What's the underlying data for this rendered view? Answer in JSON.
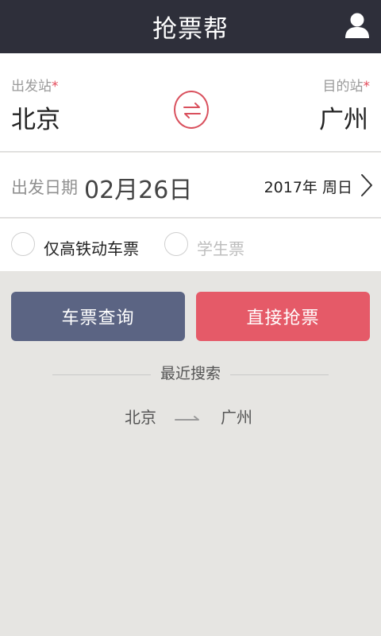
{
  "header": {
    "title": "抢票帮",
    "user_icon": "user-icon"
  },
  "stations": {
    "from_label": "出发站",
    "to_label": "目的站",
    "required_mark": "*",
    "from_name": "北京",
    "to_name": "广州",
    "swap_icon": "swap-arrows-icon"
  },
  "date": {
    "label": "出发日期",
    "value": "02月26日",
    "year": "2017年",
    "weekday": "周日"
  },
  "options": {
    "high_speed_only": "仅高铁动车票",
    "student_ticket": "学生票"
  },
  "buttons": {
    "query": "车票查询",
    "grab": "直接抢票"
  },
  "recent": {
    "title": "最近搜索",
    "items": [
      {
        "from": "北京",
        "to": "广州"
      }
    ]
  },
  "colors": {
    "header_bg": "#2e2f3a",
    "accent_red": "#e55a68",
    "query_blue": "#5b6483",
    "page_bg": "#e6e5e2"
  }
}
